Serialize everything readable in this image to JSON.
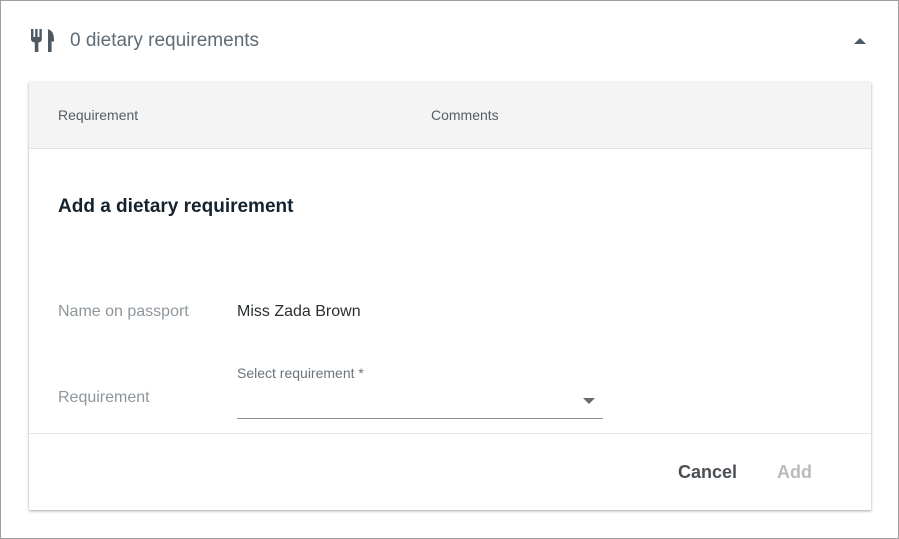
{
  "panel": {
    "icon": "fork-knife-icon",
    "title": "0 dietary requirements",
    "collapse_icon": "chevron-up-icon"
  },
  "table": {
    "columns": [
      "Requirement",
      "Comments"
    ]
  },
  "form": {
    "title": "Add a dietary requirement",
    "name_label": "Name on passport",
    "name_value": "Miss Zada Brown",
    "requirement_label": "Requirement",
    "requirement_select": {
      "placeholder": "Select requirement *",
      "value": ""
    }
  },
  "footer": {
    "cancel_label": "Cancel",
    "add_label": "Add"
  },
  "colors": {
    "add_disabled": "#b9bcbf",
    "header_bg": "#f4f4f4"
  }
}
